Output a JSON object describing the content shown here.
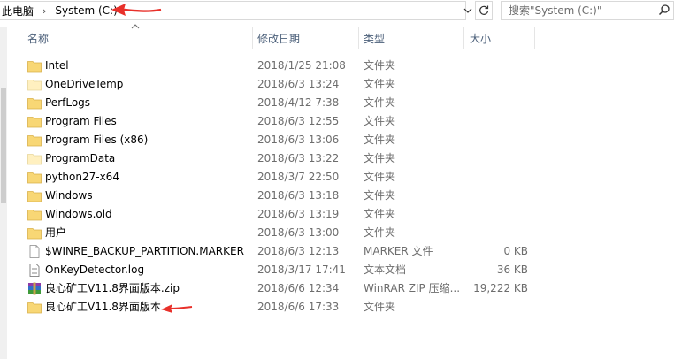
{
  "address": {
    "crumbs": [
      "此电脑",
      "System (C:)"
    ],
    "separator": "›"
  },
  "search": {
    "placeholder": "搜索\"System (C:)\""
  },
  "icons": {
    "refresh": "refresh-icon",
    "search": "search-icon",
    "dropdown": "chevron-down-icon",
    "sort": "sort-up-icon",
    "folder": "folder-icon",
    "file": "file-icon",
    "text": "text-file-icon",
    "archive": "rar-archive-icon"
  },
  "columns": {
    "name": "名称",
    "date": "修改日期",
    "type": "类型",
    "size": "大小"
  },
  "colors": {
    "folder": "#f8d775",
    "folder_light": "#fff0c0",
    "annotation": "#e8302a",
    "header_text": "#4c607a"
  },
  "files": [
    {
      "name": "Intel",
      "date": "2018/1/25 21:08",
      "type": "文件夹",
      "size": "",
      "icon": "folder"
    },
    {
      "name": "OneDriveTemp",
      "date": "2018/6/3 13:24",
      "type": "文件夹",
      "size": "",
      "icon": "folder-light"
    },
    {
      "name": "PerfLogs",
      "date": "2018/4/12 7:38",
      "type": "文件夹",
      "size": "",
      "icon": "folder"
    },
    {
      "name": "Program Files",
      "date": "2018/6/3 12:55",
      "type": "文件夹",
      "size": "",
      "icon": "folder"
    },
    {
      "name": "Program Files (x86)",
      "date": "2018/6/3 13:06",
      "type": "文件夹",
      "size": "",
      "icon": "folder"
    },
    {
      "name": "ProgramData",
      "date": "2018/6/3 13:22",
      "type": "文件夹",
      "size": "",
      "icon": "folder-light"
    },
    {
      "name": "python27-x64",
      "date": "2018/3/7 22:50",
      "type": "文件夹",
      "size": "",
      "icon": "folder"
    },
    {
      "name": "Windows",
      "date": "2018/6/3 13:18",
      "type": "文件夹",
      "size": "",
      "icon": "folder"
    },
    {
      "name": "Windows.old",
      "date": "2018/6/3 13:19",
      "type": "文件夹",
      "size": "",
      "icon": "folder"
    },
    {
      "name": "用户",
      "date": "2018/6/3 13:00",
      "type": "文件夹",
      "size": "",
      "icon": "folder"
    },
    {
      "name": "$WINRE_BACKUP_PARTITION.MARKER",
      "date": "2018/6/3 12:13",
      "type": "MARKER 文件",
      "size": "0 KB",
      "icon": "file"
    },
    {
      "name": "OnKeyDetector.log",
      "date": "2018/3/17 17:41",
      "type": "文本文档",
      "size": "36 KB",
      "icon": "text"
    },
    {
      "name": "良心矿工V11.8界面版本.zip",
      "date": "2018/6/6 12:34",
      "type": "WinRAR ZIP 压缩...",
      "size": "19,222 KB",
      "icon": "archive"
    },
    {
      "name": "良心矿工V11.8界面版本",
      "date": "2018/6/6 17:33",
      "type": "文件夹",
      "size": "",
      "icon": "folder"
    }
  ]
}
